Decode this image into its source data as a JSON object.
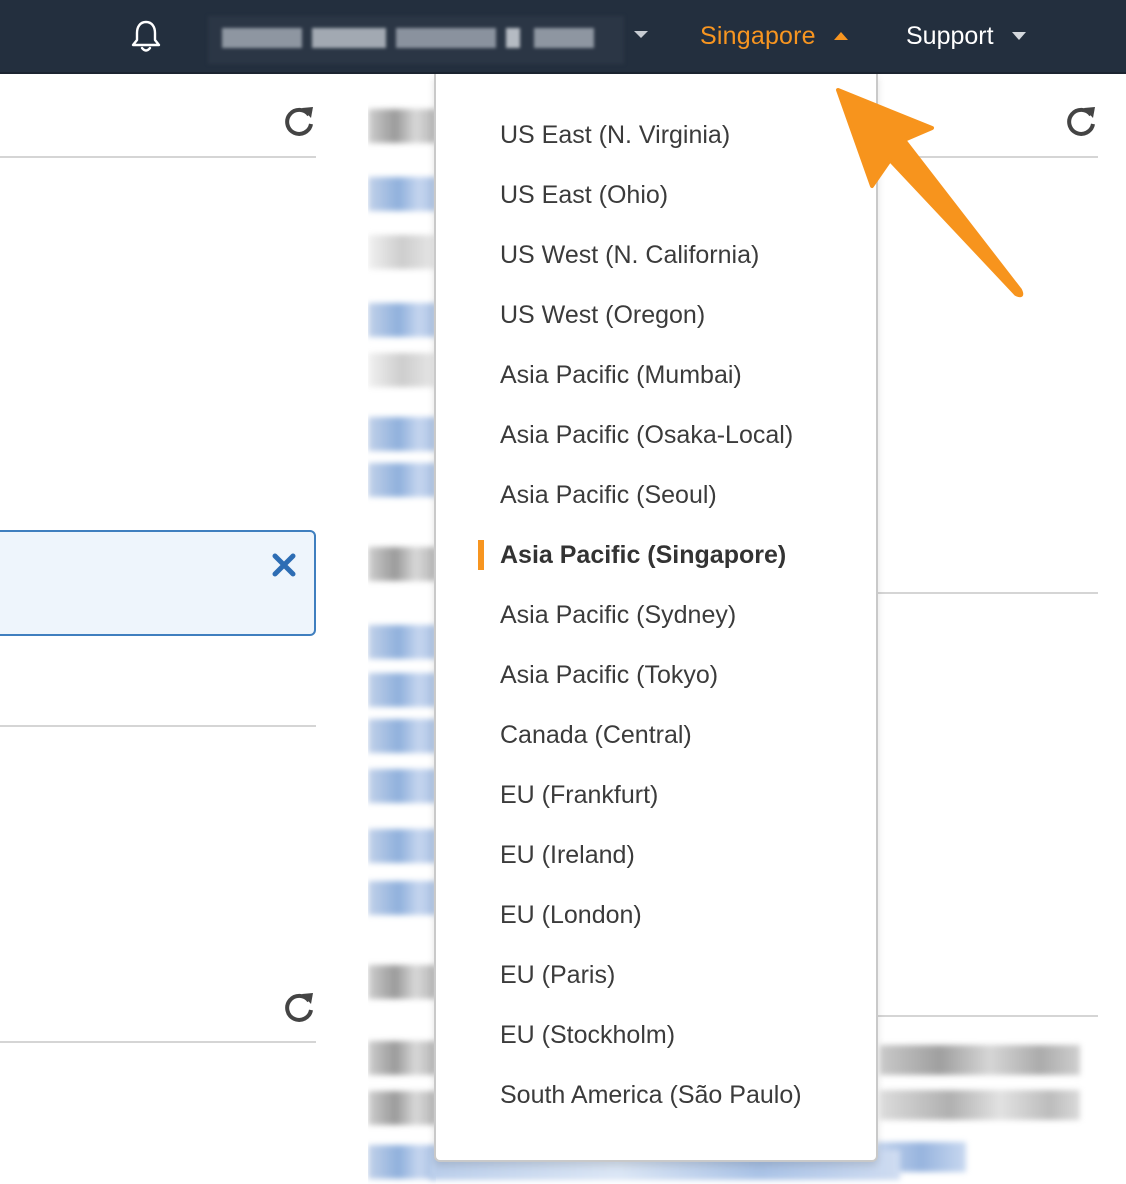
{
  "topnav": {
    "notifications_icon": "bell-icon",
    "account_menu_caret": "chevron-down-icon",
    "region_label": "Singapore",
    "region_caret": "chevron-up-icon",
    "support_label": "Support",
    "support_caret": "chevron-down-icon",
    "accent_color": "#f79520",
    "bar_color": "#232f3e"
  },
  "region_menu": {
    "selected_index": 7,
    "items": [
      "US East (N. Virginia)",
      "US East (Ohio)",
      "US West (N. California)",
      "US West (Oregon)",
      "Asia Pacific (Mumbai)",
      "Asia Pacific (Osaka-Local)",
      "Asia Pacific (Seoul)",
      "Asia Pacific (Singapore)",
      "Asia Pacific (Sydney)",
      "Asia Pacific (Tokyo)",
      "Canada (Central)",
      "EU (Frankfurt)",
      "EU (Ireland)",
      "EU (London)",
      "EU (Paris)",
      "EU (Stockholm)",
      "South America (São Paulo)"
    ]
  },
  "background": {
    "refresh_icon": "refresh-icon",
    "info_close_icon": "close-icon",
    "annotation_color": "#f7941d"
  }
}
